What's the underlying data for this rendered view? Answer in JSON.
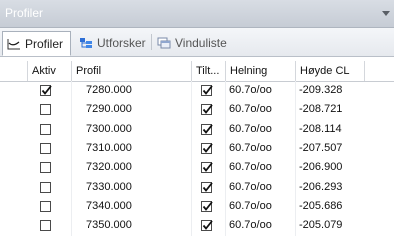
{
  "window": {
    "title": "Profiler"
  },
  "tabs": [
    {
      "label": "Profiler",
      "icon": "profile-graph-icon",
      "active": true
    },
    {
      "label": "Utforsker",
      "icon": "explorer-tree-icon",
      "active": false
    },
    {
      "label": "Vinduliste",
      "icon": "window-list-icon",
      "active": false
    }
  ],
  "table": {
    "columns": [
      "Aktiv",
      "Profil",
      "Tilt...",
      "Helning",
      "Høyde CL"
    ],
    "rows": [
      {
        "aktiv": true,
        "profil": "7280.000",
        "tilt": true,
        "helning": "60.7o/oo",
        "hoyde": "-209.328"
      },
      {
        "aktiv": false,
        "profil": "7290.000",
        "tilt": true,
        "helning": "60.7o/oo",
        "hoyde": "-208.721"
      },
      {
        "aktiv": false,
        "profil": "7300.000",
        "tilt": true,
        "helning": "60.7o/oo",
        "hoyde": "-208.114"
      },
      {
        "aktiv": false,
        "profil": "7310.000",
        "tilt": true,
        "helning": "60.7o/oo",
        "hoyde": "-207.507"
      },
      {
        "aktiv": false,
        "profil": "7320.000",
        "tilt": true,
        "helning": "60.7o/oo",
        "hoyde": "-206.900"
      },
      {
        "aktiv": false,
        "profil": "7330.000",
        "tilt": true,
        "helning": "60.7o/oo",
        "hoyde": "-206.293"
      },
      {
        "aktiv": false,
        "profil": "7340.000",
        "tilt": true,
        "helning": "60.7o/oo",
        "hoyde": "-205.686"
      },
      {
        "aktiv": false,
        "profil": "7350.000",
        "tilt": true,
        "helning": "60.7o/oo",
        "hoyde": "-205.079"
      }
    ]
  }
}
